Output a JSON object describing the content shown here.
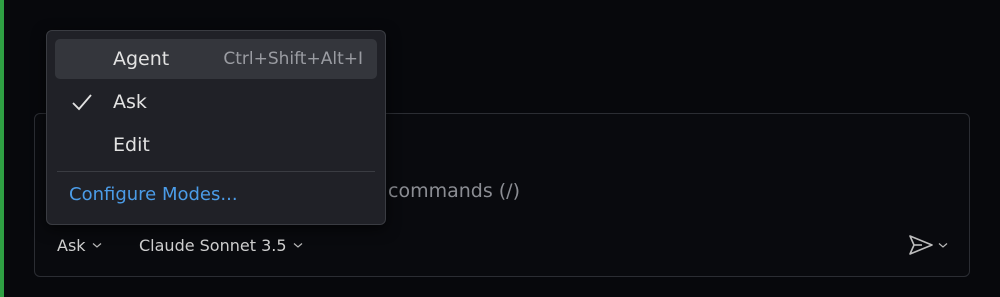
{
  "chat": {
    "input_hint": "commands (/)",
    "mode_picker": {
      "label": "Ask"
    },
    "model_picker": {
      "label": "Claude Sonnet 3.5"
    },
    "send_icon": "send-icon"
  },
  "mode_menu": {
    "items": [
      {
        "label": "Agent",
        "shortcut": "Ctrl+Shift+Alt+I",
        "checked": false,
        "highlighted": true
      },
      {
        "label": "Ask",
        "shortcut": "",
        "checked": true,
        "highlighted": false
      },
      {
        "label": "Edit",
        "shortcut": "",
        "checked": false,
        "highlighted": false
      }
    ],
    "configure_label": "Configure Modes..."
  },
  "colors": {
    "accent_link": "#4b9ce8",
    "edge_bar": "#2ea043",
    "menu_bg": "#202127",
    "highlight_bg": "#34363c"
  }
}
